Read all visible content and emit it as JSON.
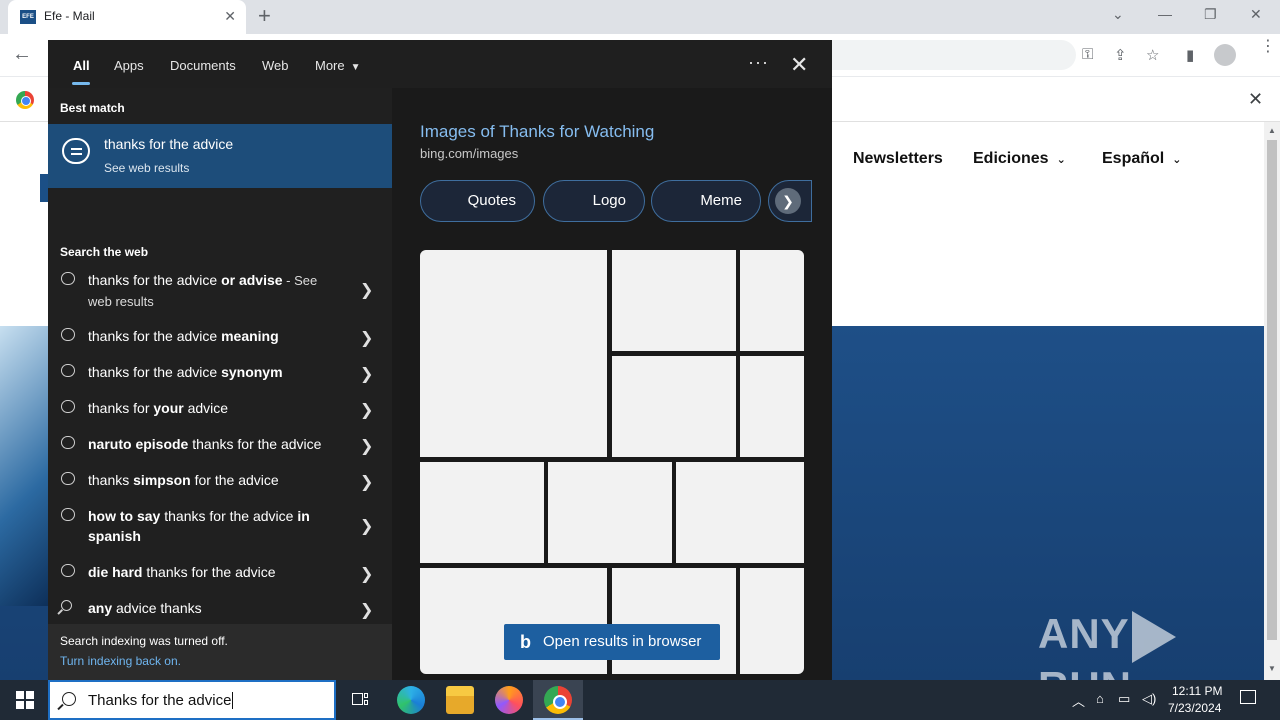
{
  "browser": {
    "tab_title": "Efe - Mail",
    "tab_close": "✕",
    "new_tab": "+",
    "favicon_text": "EFE"
  },
  "page": {
    "nav": {
      "newsletters": "Newsletters",
      "ediciones": "Ediciones",
      "espanol": "Español"
    },
    "watermark": {
      "left": "ANY",
      "right": "RUN"
    }
  },
  "search": {
    "filters": {
      "all": "All",
      "apps": "Apps",
      "documents": "Documents",
      "web": "Web",
      "more": "More"
    },
    "best_match_heading": "Best match",
    "best_match": {
      "title": "thanks for the advice",
      "subtitle": "See web results"
    },
    "search_web_heading": "Search the web",
    "suggestions": [
      {
        "pre": "thanks for the advice ",
        "bold": "or advise",
        "post": "",
        "small": " - See web results",
        "icon": "chat-icon"
      },
      {
        "pre": "thanks for the advice ",
        "bold": "meaning",
        "post": "",
        "small": "",
        "icon": "chat-icon"
      },
      {
        "pre": "thanks for the advice ",
        "bold": "synonym",
        "post": "",
        "small": "",
        "icon": "chat-icon"
      },
      {
        "pre": "thanks for ",
        "bold": "your",
        "post": " advice",
        "small": "",
        "icon": "chat-icon"
      },
      {
        "pre": "",
        "bold": "naruto episode",
        "post": " thanks for the advice",
        "small": "",
        "icon": "chat-icon"
      },
      {
        "pre": "thanks ",
        "bold": "simpson",
        "post": " for the advice",
        "small": "",
        "icon": "chat-icon"
      },
      {
        "pre": "",
        "bold": "how to say",
        "post": " thanks for the advice ",
        "bold2": "in spanish",
        "small": "",
        "icon": "chat-icon"
      },
      {
        "pre": "",
        "bold": "die hard",
        "post": " thanks for the advice",
        "small": "",
        "icon": "chat-icon"
      },
      {
        "pre": "",
        "bold": "any",
        "post": " advice thanks",
        "small": "",
        "icon": "search-icon"
      }
    ],
    "index_message": "Search indexing was turned off.",
    "index_link": "Turn indexing back on.",
    "preview": {
      "title": "Images of Thanks for Watching",
      "source": "bing.com/images",
      "pills": [
        "Quotes",
        "Logo",
        "Meme"
      ],
      "open_button": "Open results in browser"
    }
  },
  "taskbar": {
    "search_text": "Thanks for the advice",
    "time": "12:11 PM",
    "date": "7/23/2024"
  },
  "colors": {
    "panel_bg": "#1f1f1f",
    "best_match_bg": "#1d4d7a",
    "link_blue": "#86bdf0",
    "taskbar_bg": "#202a36"
  }
}
